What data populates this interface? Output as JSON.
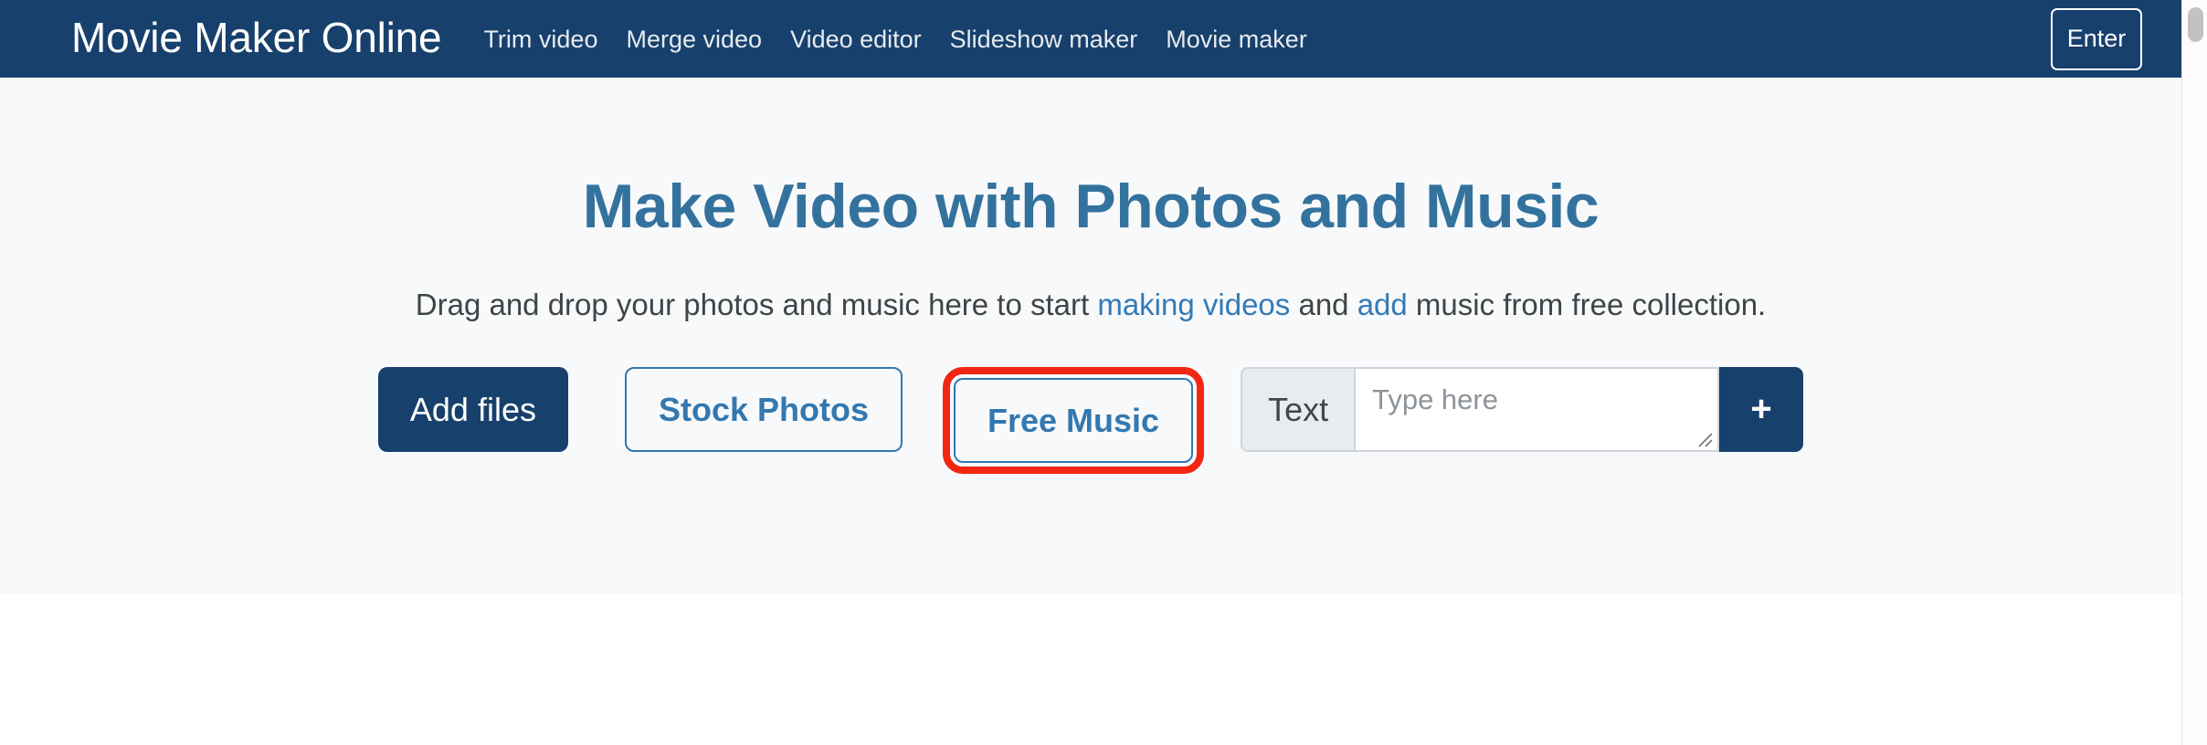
{
  "navbar": {
    "brand": "Movie Maker Online",
    "links": [
      {
        "label": "Trim video"
      },
      {
        "label": "Merge video"
      },
      {
        "label": "Video editor"
      },
      {
        "label": "Slideshow maker"
      },
      {
        "label": "Movie maker"
      }
    ],
    "enter_label": "Enter",
    "background_color": "#17406d"
  },
  "hero": {
    "title": "Make Video with Photos and Music",
    "title_color": "#34729e",
    "background_color": "#f8f9fa",
    "subtitle": {
      "part1": "Drag and drop your photos and music here to start ",
      "link1": "making videos",
      "part2": " and ",
      "link2": "add",
      "part3": " music from free collection.",
      "link_color": "#337ab7"
    },
    "actions": {
      "add_files_label": "Add files",
      "stock_photos_label": "Stock Photos",
      "free_music_label": "Free Music",
      "text_label": "Text",
      "text_placeholder": "Type here",
      "text_value": "",
      "add_text_label": "+",
      "primary_color": "#17406d",
      "outline_color": "#3378b0",
      "highlight_color": "#f22613"
    }
  },
  "annotation": {
    "target": "Free Music",
    "shape": "rounded-rectangle",
    "color": "#f22613"
  }
}
